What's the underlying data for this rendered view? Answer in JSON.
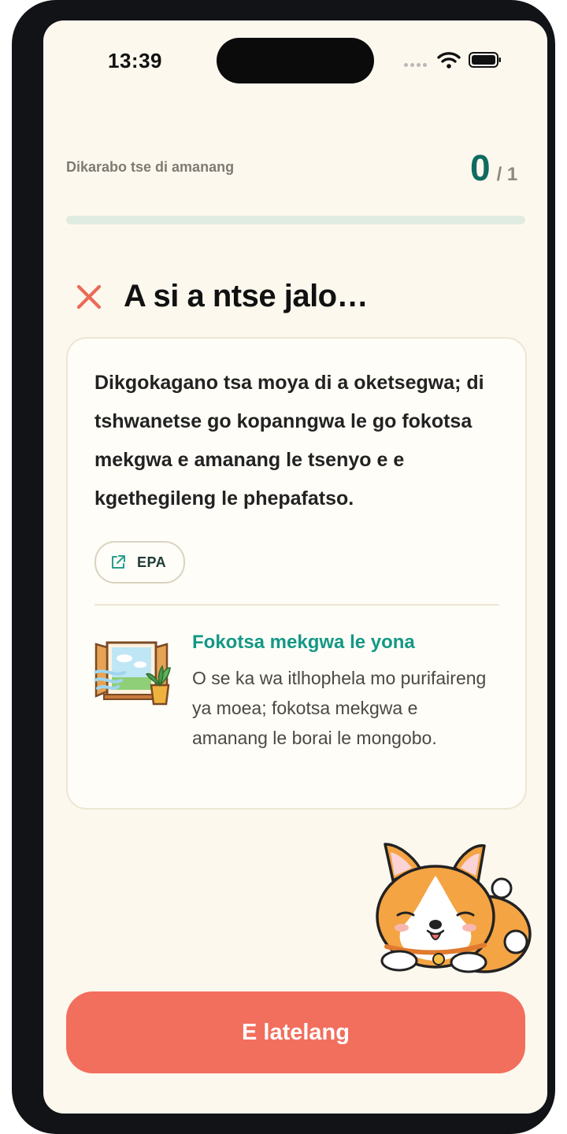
{
  "status_bar": {
    "time": "13:39"
  },
  "progress": {
    "label": "Dikarabo tse di amanang",
    "current": "0",
    "total": "/ 1",
    "fraction": 0
  },
  "result": {
    "title": "A si a ntse jalo…",
    "icon": "close-x-icon"
  },
  "explanation": {
    "text": "Dikgokagano tsa moya di a oketsegwa; di tshwanetse go kopanngwa le go fokotsa mekgwa e amanang le tsenyo e e kgethegileng le phepafatso."
  },
  "source": {
    "label": "EPA",
    "icon": "external-link-icon"
  },
  "tip": {
    "title": "Fokotsa mekgwa le yona",
    "text": "O se ka wa itlhophela mo purifaireng ya moea; fokotsa mekgwa e amanang le borai le mongobo.",
    "illustration": "open-window-plant-icon"
  },
  "mascot": {
    "icon": "sleeping-corgi-icon"
  },
  "cta": {
    "label": "E latelang"
  },
  "colors": {
    "background": "#fdf8ee",
    "accent_teal": "#0e6b61",
    "tip_teal": "#139886",
    "error": "#f26e5d",
    "cta": "#f26e5d"
  }
}
